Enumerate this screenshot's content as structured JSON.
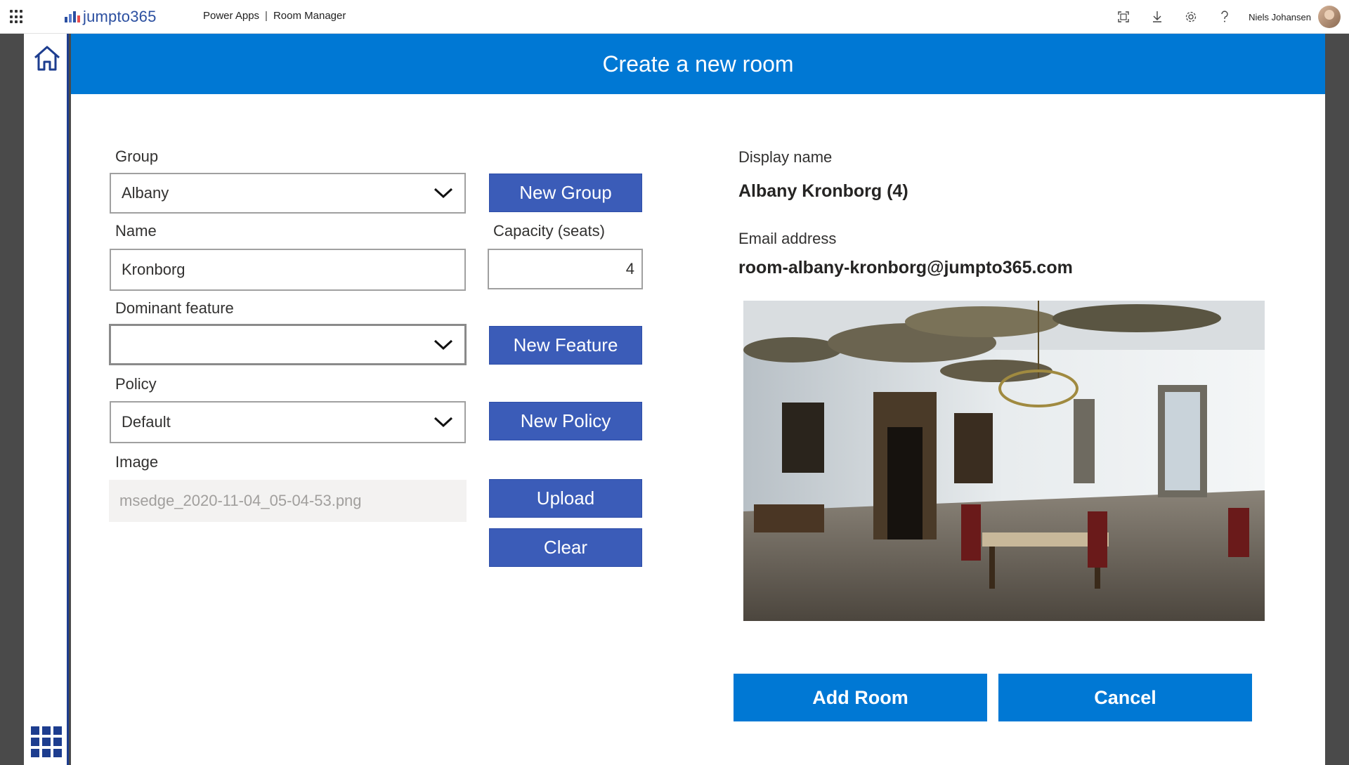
{
  "suite": {
    "logo_text": "jumpto365",
    "app_name": "Power Apps",
    "separator": "|",
    "app_title": "Room Manager",
    "user_name": "Niels Johansen"
  },
  "header": {
    "title": "Create a new room"
  },
  "form": {
    "group": {
      "label": "Group",
      "value": "Albany",
      "new_button": "New Group"
    },
    "name": {
      "label": "Name",
      "value": "Kronborg"
    },
    "capacity": {
      "label": "Capacity (seats)",
      "value": "4"
    },
    "dominant_feature": {
      "label": "Dominant feature",
      "value": "",
      "new_button": "New Feature"
    },
    "policy": {
      "label": "Policy",
      "value": "Default",
      "new_button": "New Policy"
    },
    "image": {
      "label": "Image",
      "value": "msedge_2020-11-04_05-04-53.png",
      "upload_button": "Upload",
      "clear_button": "Clear"
    }
  },
  "summary": {
    "display_name_label": "Display name",
    "display_name_value": "Albany Kronborg  (4)",
    "email_label": "Email address",
    "email_value": "room-albany-kronborg@jumpto365.com"
  },
  "actions": {
    "add_label": "Add Room",
    "cancel_label": "Cancel"
  },
  "colors": {
    "header": "#0078d4",
    "secondary_button": "#3b5cb8",
    "primary_button": "#0078d4",
    "rail_accent": "#1d3d8f"
  },
  "icons": [
    "app-launcher-icon",
    "focus-icon",
    "download-icon",
    "settings-icon",
    "help-icon",
    "home-icon",
    "apps-grid-icon",
    "chevron-down-icon"
  ]
}
